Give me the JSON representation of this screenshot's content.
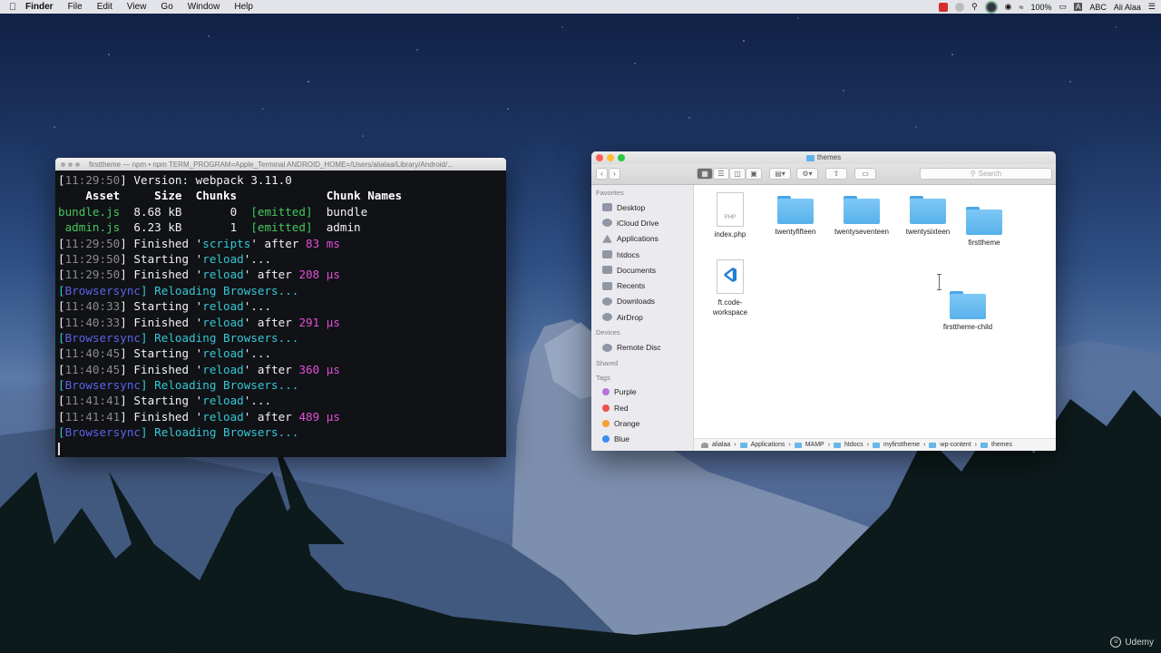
{
  "menubar": {
    "app": "Finder",
    "items": [
      "File",
      "Edit",
      "View",
      "Go",
      "Window",
      "Help"
    ],
    "battery": "100%",
    "input": "ABC",
    "user": "Ali Alaa"
  },
  "terminal": {
    "title": "firsttheme — npm • npm TERM_PROGRAM=Apple_Terminal ANDROID_HOME=/Users/alialaa/Library/Android/...",
    "lines": [
      [
        {
          "t": "[",
          "c": "c-white"
        },
        {
          "t": "11:29:50",
          "c": "c-gray"
        },
        {
          "t": "] Version: webpack 3.11.0",
          "c": "c-white"
        }
      ],
      [
        {
          "t": "    Asset     Size  Chunks             Chunk Names",
          "c": "c-bold"
        }
      ],
      [
        {
          "t": "bundle.js",
          "c": "c-green"
        },
        {
          "t": "  8.68 kB       0  ",
          "c": "c-white"
        },
        {
          "t": "[emitted]",
          "c": "c-green"
        },
        {
          "t": "  bundle",
          "c": "c-white"
        }
      ],
      [
        {
          "t": " admin.js",
          "c": "c-green"
        },
        {
          "t": "  6.23 kB       1  ",
          "c": "c-white"
        },
        {
          "t": "[emitted]",
          "c": "c-green"
        },
        {
          "t": "  admin",
          "c": "c-white"
        }
      ],
      [
        {
          "t": "[",
          "c": "c-white"
        },
        {
          "t": "11:29:50",
          "c": "c-gray"
        },
        {
          "t": "] Finished '",
          "c": "c-white"
        },
        {
          "t": "scripts",
          "c": "c-cyan"
        },
        {
          "t": "' after ",
          "c": "c-white"
        },
        {
          "t": "83 ms",
          "c": "c-mag"
        }
      ],
      [
        {
          "t": "[",
          "c": "c-white"
        },
        {
          "t": "11:29:50",
          "c": "c-gray"
        },
        {
          "t": "] Starting '",
          "c": "c-white"
        },
        {
          "t": "reload",
          "c": "c-cyan"
        },
        {
          "t": "'...",
          "c": "c-white"
        }
      ],
      [
        {
          "t": "[",
          "c": "c-white"
        },
        {
          "t": "11:29:50",
          "c": "c-gray"
        },
        {
          "t": "] Finished '",
          "c": "c-white"
        },
        {
          "t": "reload",
          "c": "c-cyan"
        },
        {
          "t": "' after ",
          "c": "c-white"
        },
        {
          "t": "208 μs",
          "c": "c-mag"
        }
      ],
      [
        {
          "t": "[",
          "c": "c-cyan"
        },
        {
          "t": "Browsersync",
          "c": "c-blue"
        },
        {
          "t": "] Reloading Browsers...",
          "c": "c-cyan"
        }
      ],
      [
        {
          "t": "[",
          "c": "c-white"
        },
        {
          "t": "11:40:33",
          "c": "c-gray"
        },
        {
          "t": "] Starting '",
          "c": "c-white"
        },
        {
          "t": "reload",
          "c": "c-cyan"
        },
        {
          "t": "'...",
          "c": "c-white"
        }
      ],
      [
        {
          "t": "[",
          "c": "c-white"
        },
        {
          "t": "11:40:33",
          "c": "c-gray"
        },
        {
          "t": "] Finished '",
          "c": "c-white"
        },
        {
          "t": "reload",
          "c": "c-cyan"
        },
        {
          "t": "' after ",
          "c": "c-white"
        },
        {
          "t": "291 μs",
          "c": "c-mag"
        }
      ],
      [
        {
          "t": "[",
          "c": "c-cyan"
        },
        {
          "t": "Browsersync",
          "c": "c-blue"
        },
        {
          "t": "] Reloading Browsers...",
          "c": "c-cyan"
        }
      ],
      [
        {
          "t": "[",
          "c": "c-white"
        },
        {
          "t": "11:40:45",
          "c": "c-gray"
        },
        {
          "t": "] Starting '",
          "c": "c-white"
        },
        {
          "t": "reload",
          "c": "c-cyan"
        },
        {
          "t": "'...",
          "c": "c-white"
        }
      ],
      [
        {
          "t": "[",
          "c": "c-white"
        },
        {
          "t": "11:40:45",
          "c": "c-gray"
        },
        {
          "t": "] Finished '",
          "c": "c-white"
        },
        {
          "t": "reload",
          "c": "c-cyan"
        },
        {
          "t": "' after ",
          "c": "c-white"
        },
        {
          "t": "360 μs",
          "c": "c-mag"
        }
      ],
      [
        {
          "t": "[",
          "c": "c-cyan"
        },
        {
          "t": "Browsersync",
          "c": "c-blue"
        },
        {
          "t": "] Reloading Browsers...",
          "c": "c-cyan"
        }
      ],
      [
        {
          "t": "[",
          "c": "c-white"
        },
        {
          "t": "11:41:41",
          "c": "c-gray"
        },
        {
          "t": "] Starting '",
          "c": "c-white"
        },
        {
          "t": "reload",
          "c": "c-cyan"
        },
        {
          "t": "'...",
          "c": "c-white"
        }
      ],
      [
        {
          "t": "[",
          "c": "c-white"
        },
        {
          "t": "11:41:41",
          "c": "c-gray"
        },
        {
          "t": "] Finished '",
          "c": "c-white"
        },
        {
          "t": "reload",
          "c": "c-cyan"
        },
        {
          "t": "' after ",
          "c": "c-white"
        },
        {
          "t": "489 μs",
          "c": "c-mag"
        }
      ],
      [
        {
          "t": "[",
          "c": "c-cyan"
        },
        {
          "t": "Browsersync",
          "c": "c-blue"
        },
        {
          "t": "] Reloading Browsers...",
          "c": "c-cyan"
        }
      ]
    ]
  },
  "finder": {
    "title": "themes",
    "search_placeholder": "Search",
    "sidebar": {
      "favorites_label": "Favorites",
      "favorites": [
        "Desktop",
        "iCloud Drive",
        "Applications",
        "htdocs",
        "Documents",
        "Recents",
        "Downloads",
        "AirDrop"
      ],
      "devices_label": "Devices",
      "devices": [
        "Remote Disc"
      ],
      "shared_label": "Shared",
      "tags_label": "Tags",
      "tags": [
        {
          "name": "Purple",
          "color": "#b873d8"
        },
        {
          "name": "Red",
          "color": "#f0504a"
        },
        {
          "name": "Orange",
          "color": "#f5a038"
        },
        {
          "name": "Blue",
          "color": "#3a8ef0"
        }
      ]
    },
    "items": {
      "index": "index.php",
      "index_badge": "PHP",
      "twentyfifteen": "twentyfifteen",
      "twentyseventeen": "twentyseventeen",
      "twentysixteen": "twentysixteen",
      "firsttheme": "firsttheme",
      "workspace": "ft.code-\nworkspace",
      "child": "firsttheme-child"
    },
    "path": [
      "alialaa",
      "Applications",
      "MAMP",
      "htdocs",
      "myfirsttheme",
      "wp-content",
      "themes"
    ]
  },
  "watermark": "Udemy"
}
